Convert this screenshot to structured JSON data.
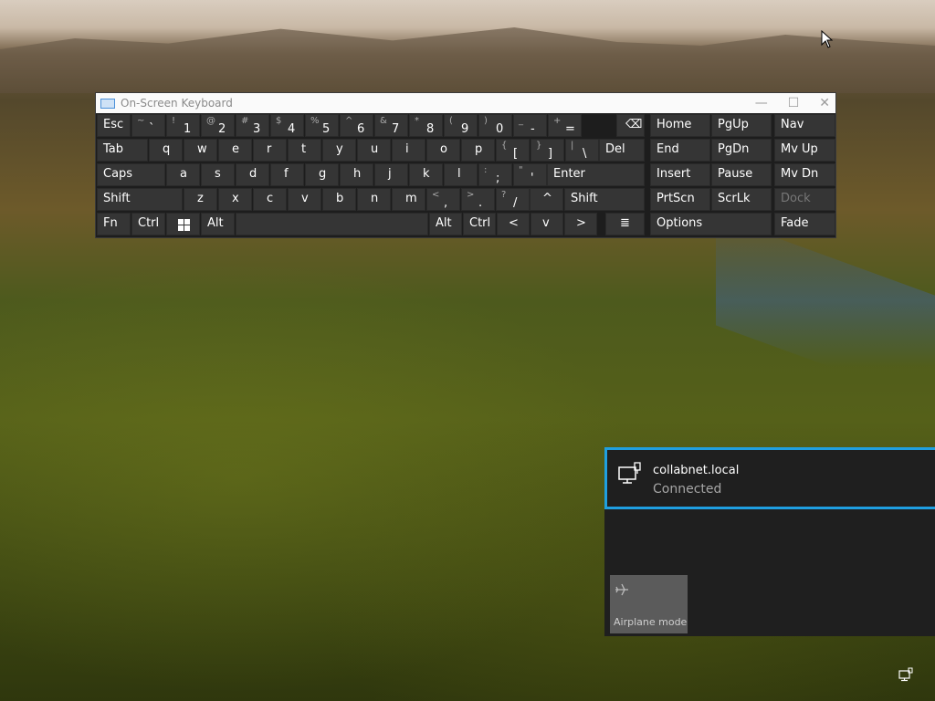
{
  "osk": {
    "title": "On-Screen Keyboard",
    "row1": [
      {
        "shift": "~",
        "main": "`"
      },
      {
        "shift": "!",
        "main": "1"
      },
      {
        "shift": "@",
        "main": "2"
      },
      {
        "shift": "#",
        "main": "3"
      },
      {
        "shift": "$",
        "main": "4"
      },
      {
        "shift": "%",
        "main": "5"
      },
      {
        "shift": "^",
        "main": "6"
      },
      {
        "shift": "&",
        "main": "7"
      },
      {
        "shift": "*",
        "main": "8"
      },
      {
        "shift": "(",
        "main": "9"
      },
      {
        "shift": ")",
        "main": "0"
      },
      {
        "shift": "_",
        "main": "-"
      },
      {
        "shift": "+",
        "main": "="
      }
    ],
    "row2": [
      {
        "shift": "",
        "main": "q"
      },
      {
        "shift": "",
        "main": "w"
      },
      {
        "shift": "",
        "main": "e"
      },
      {
        "shift": "",
        "main": "r"
      },
      {
        "shift": "",
        "main": "t"
      },
      {
        "shift": "",
        "main": "y"
      },
      {
        "shift": "",
        "main": "u"
      },
      {
        "shift": "",
        "main": "i"
      },
      {
        "shift": "",
        "main": "o"
      },
      {
        "shift": "",
        "main": "p"
      },
      {
        "shift": "{",
        "main": "["
      },
      {
        "shift": "}",
        "main": "]"
      },
      {
        "shift": "|",
        "main": "\\"
      }
    ],
    "row3": [
      {
        "shift": "",
        "main": "a"
      },
      {
        "shift": "",
        "main": "s"
      },
      {
        "shift": "",
        "main": "d"
      },
      {
        "shift": "",
        "main": "f"
      },
      {
        "shift": "",
        "main": "g"
      },
      {
        "shift": "",
        "main": "h"
      },
      {
        "shift": "",
        "main": "j"
      },
      {
        "shift": "",
        "main": "k"
      },
      {
        "shift": "",
        "main": "l"
      },
      {
        "shift": ":",
        "main": ";"
      },
      {
        "shift": "\"",
        "main": "'"
      }
    ],
    "row4": [
      {
        "shift": "",
        "main": "z"
      },
      {
        "shift": "",
        "main": "x"
      },
      {
        "shift": "",
        "main": "c"
      },
      {
        "shift": "",
        "main": "v"
      },
      {
        "shift": "",
        "main": "b"
      },
      {
        "shift": "",
        "main": "n"
      },
      {
        "shift": "",
        "main": "m"
      },
      {
        "shift": "<",
        "main": ","
      },
      {
        "shift": ">",
        "main": "."
      },
      {
        "shift": "?",
        "main": "/"
      }
    ],
    "keys": {
      "esc": "Esc",
      "tab": "Tab",
      "caps": "Caps",
      "shift": "Shift",
      "fn": "Fn",
      "ctrl": "Ctrl",
      "alt": "Alt",
      "del": "Del",
      "enter": "Enter",
      "backspace": "⌫",
      "left": "<",
      "up": "^",
      "down": "v",
      "right": ">",
      "menu": "≣",
      "home": "Home",
      "pgup": "PgUp",
      "nav": "Nav",
      "end": "End",
      "pgdn": "PgDn",
      "mvup": "Mv Up",
      "insert": "Insert",
      "pause": "Pause",
      "mvdn": "Mv Dn",
      "prtscn": "PrtScn",
      "scrlk": "ScrLk",
      "dock": "Dock",
      "options": "Options",
      "fade": "Fade"
    }
  },
  "network": {
    "name": "collabnet.local",
    "status": "Connected",
    "airplane_label": "Airplane mode"
  },
  "colors": {
    "accent": "#1f9fe0"
  }
}
